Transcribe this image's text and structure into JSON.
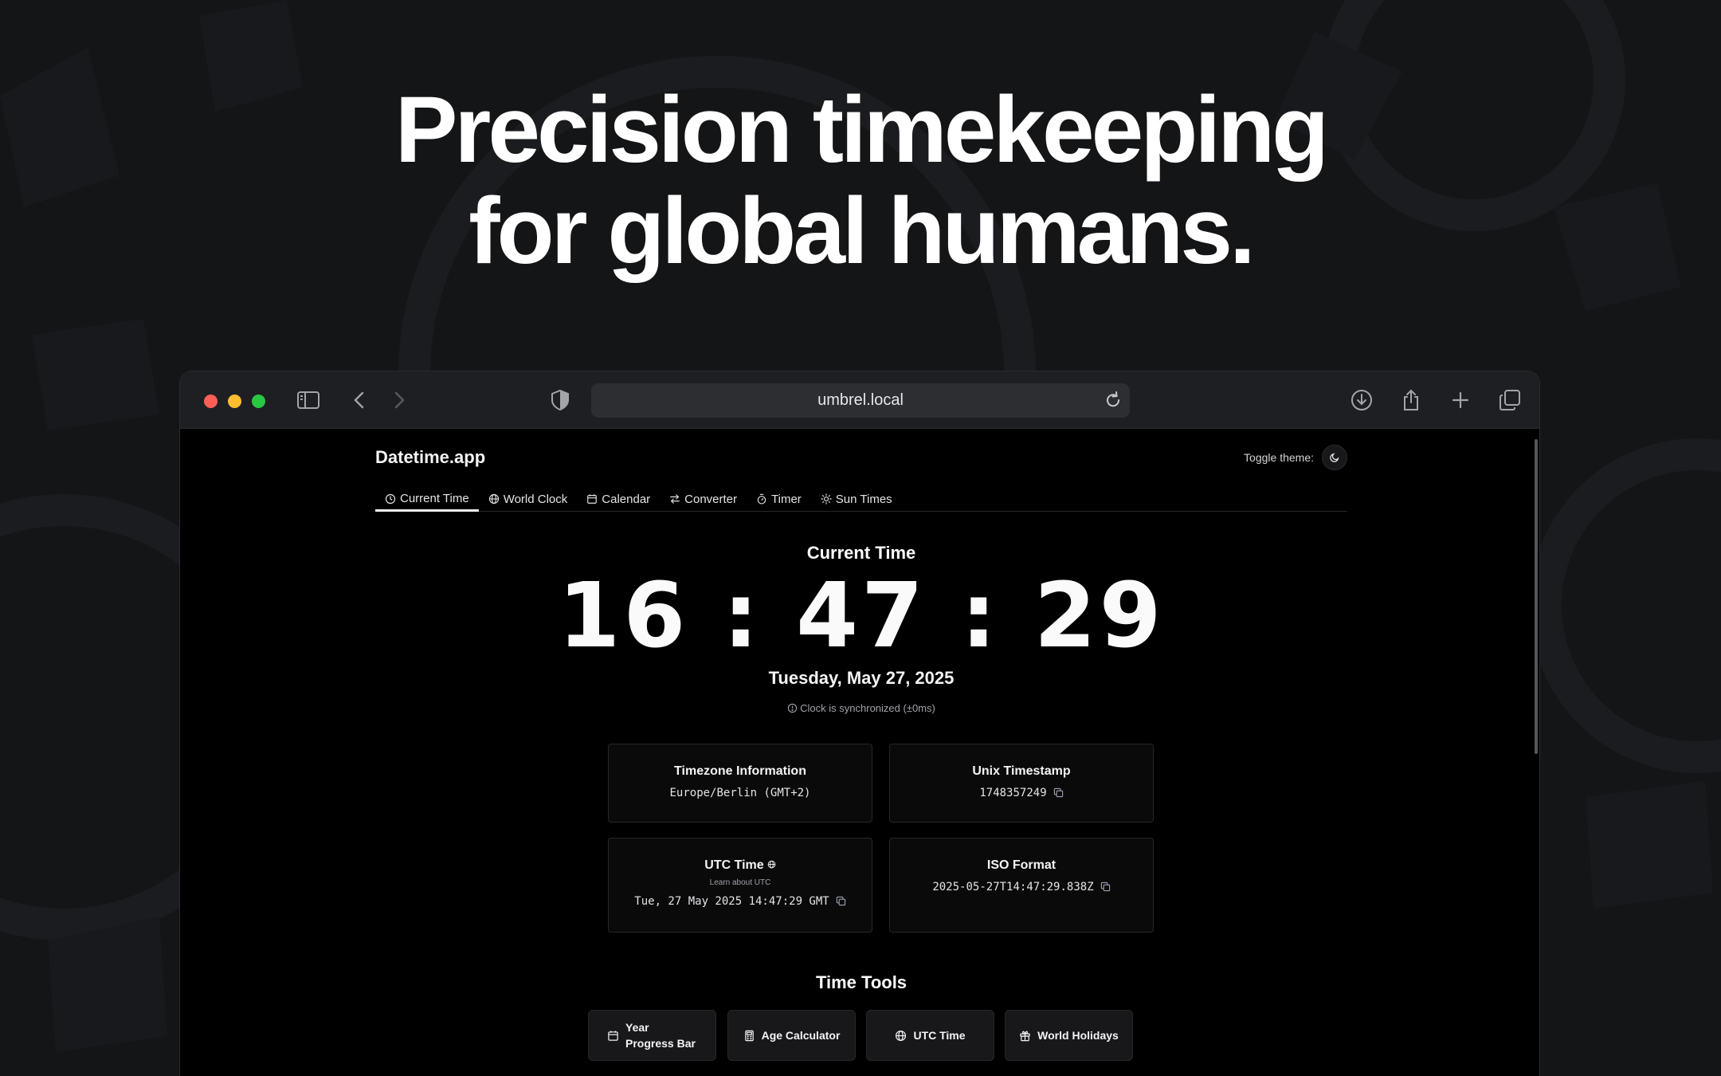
{
  "hero": {
    "line1": "Precision timekeeping",
    "line2": "for global humans."
  },
  "browser": {
    "url": "umbrel.local"
  },
  "app": {
    "brand": "Datetime.app",
    "theme_label": "Toggle theme:",
    "tabs": [
      {
        "label": "Current Time",
        "icon": "clock-icon",
        "active": true
      },
      {
        "label": "World Clock",
        "icon": "globe-icon"
      },
      {
        "label": "Calendar",
        "icon": "calendar-icon"
      },
      {
        "label": "Converter",
        "icon": "arrows-icon"
      },
      {
        "label": "Timer",
        "icon": "stopwatch-icon"
      },
      {
        "label": "Sun Times",
        "icon": "sun-icon"
      }
    ]
  },
  "current": {
    "heading": "Current Time",
    "hours": "16",
    "minutes": "47",
    "seconds": "29",
    "date": "Tuesday, May 27, 2025",
    "sync": "Clock is synchronized (±0ms)"
  },
  "cards": {
    "timezone": {
      "title": "Timezone Information",
      "value": "Europe/Berlin (GMT+2)"
    },
    "unix": {
      "title": "Unix Timestamp",
      "value": "1748357249"
    },
    "utc": {
      "title": "UTC Time",
      "sub": "Learn about UTC",
      "value": "Tue, 27 May 2025 14:47:29 GMT"
    },
    "iso": {
      "title": "ISO Format",
      "value": "2025-05-27T14:47:29.838Z"
    }
  },
  "tools": {
    "heading": "Time Tools",
    "items": [
      {
        "label": "Year Progress Bar",
        "icon": "calendar-icon"
      },
      {
        "label": "Age Calculator",
        "icon": "calculator-icon"
      },
      {
        "label": "UTC Time",
        "icon": "globe-icon"
      },
      {
        "label": "World Holidays",
        "icon": "gift-icon"
      }
    ]
  },
  "colors": {
    "background": "#141517",
    "browser_chrome": "#1e1f22",
    "page": "#000000",
    "accent": "#f4f4f5"
  }
}
